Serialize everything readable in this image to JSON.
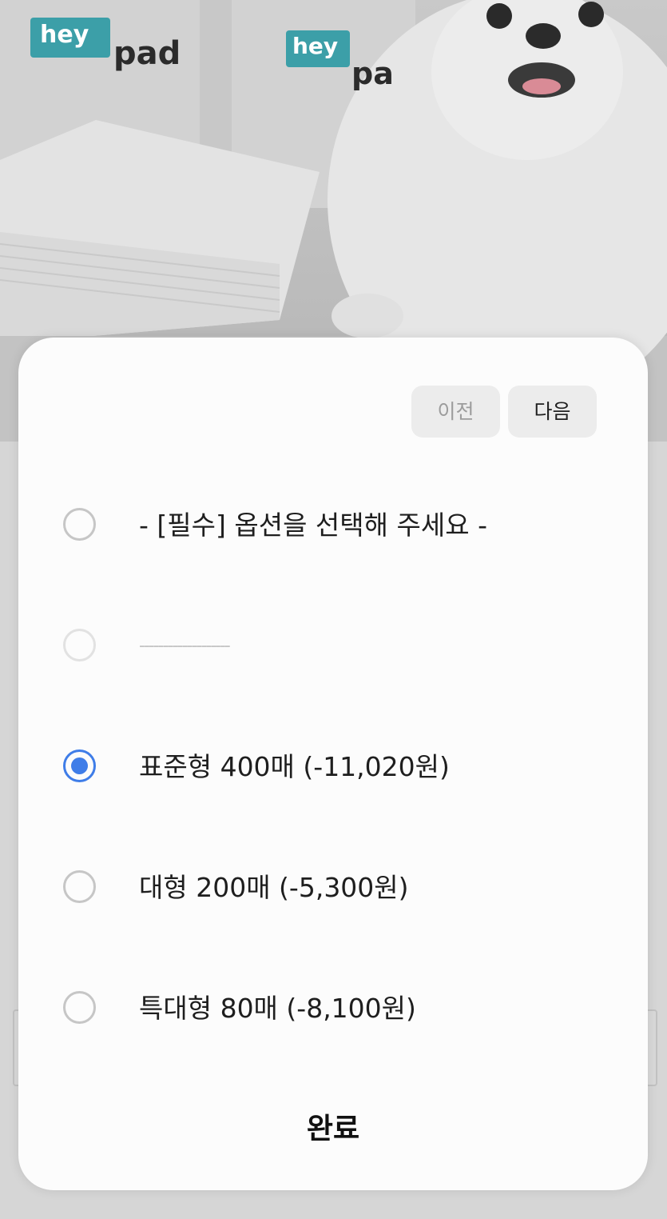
{
  "background": {
    "brand_logo_1": {
      "top": "hey",
      "bottom": "pad"
    },
    "brand_logo_2": {
      "top": "hey",
      "bottom": "pa"
    }
  },
  "dialog": {
    "prev_label": "이전",
    "next_label": "다음",
    "options": [
      {
        "label": "- [필수] 옵션을 선택해 주세요 -",
        "selected": false,
        "disabled": false
      },
      {
        "label": "-------------------",
        "selected": false,
        "disabled": true
      },
      {
        "label": "표준형 400매 (-11,020원)",
        "selected": true,
        "disabled": false
      },
      {
        "label": "대형 200매 (-5,300원)",
        "selected": false,
        "disabled": false
      },
      {
        "label": "특대형 80매 (-8,100원)",
        "selected": false,
        "disabled": false
      }
    ],
    "done_label": "완료"
  },
  "colors": {
    "accent": "#3f7de8",
    "overlay_gray": "#d6d6d6",
    "sheet": "#fcfcfc",
    "logo_teal": "#3c9fa8"
  }
}
